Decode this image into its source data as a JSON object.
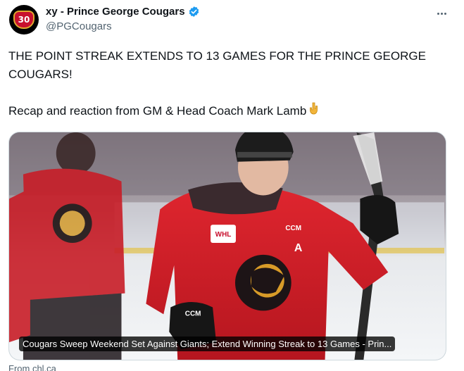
{
  "account": {
    "display_name": "xy - Prince George Cougars",
    "handle": "@PGCougars",
    "avatar_text": "30"
  },
  "tweet": {
    "line1": "THE POINT STREAK EXTENDS TO 13 GAMES FOR THE PRINCE GEORGE COUGARS!",
    "line2": "Recap and reaction from GM & Head Coach Mark Lamb",
    "emoji_icon": "backhand-index-pointing-down"
  },
  "card": {
    "caption": "Cougars Sweep Weekend Set Against Giants; Extend Winning Streak to 13 Games - Prin...",
    "jersey_brand": "CCM",
    "jersey_league": "WHL",
    "jersey_letter": "A",
    "glove_brand": "CCM"
  },
  "source": "From chl.ca",
  "colors": {
    "accent": "#1d9bf0",
    "jersey_red": "#d4202a",
    "text_secondary": "#536471"
  }
}
